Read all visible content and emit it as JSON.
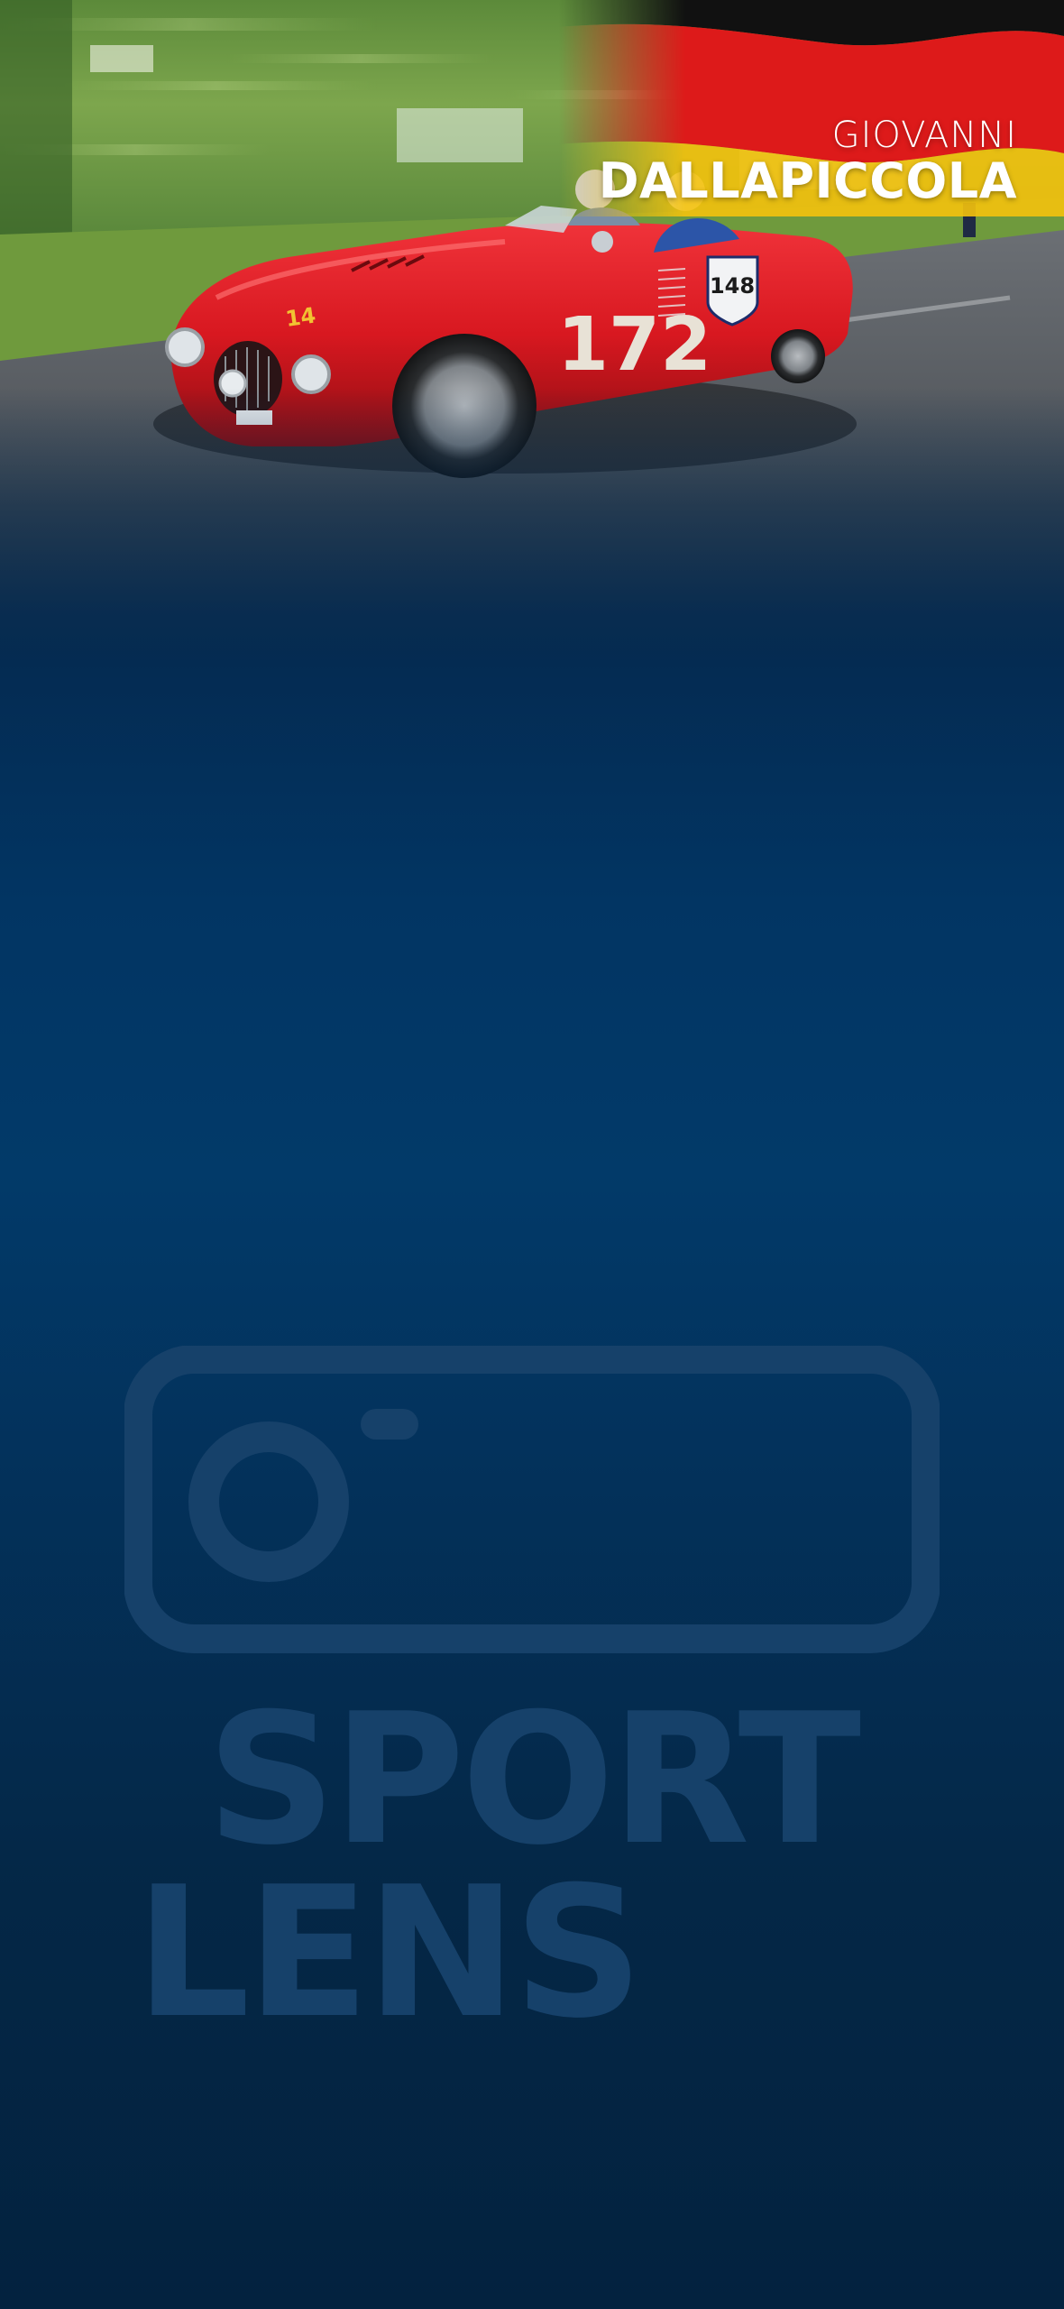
{
  "player": {
    "first_name": "GIOVANNI",
    "last_name": "DALLAPICCOLA",
    "country_flag": "germany-flag-icon"
  },
  "photo": {
    "car_number": "172",
    "plate_number": "148",
    "front_number": "14"
  },
  "brand": {
    "logo_line_1": "SPORT",
    "logo_line_2": "LENS",
    "icon": "camera-icon"
  },
  "colors": {
    "flag_black": "#111111",
    "flag_red": "#dd1a1a",
    "flag_gold": "#f4c20d",
    "car_red": "#d81820",
    "background_top": "#042b52",
    "background_bottom": "#03223f",
    "watermark": "#16416a"
  }
}
